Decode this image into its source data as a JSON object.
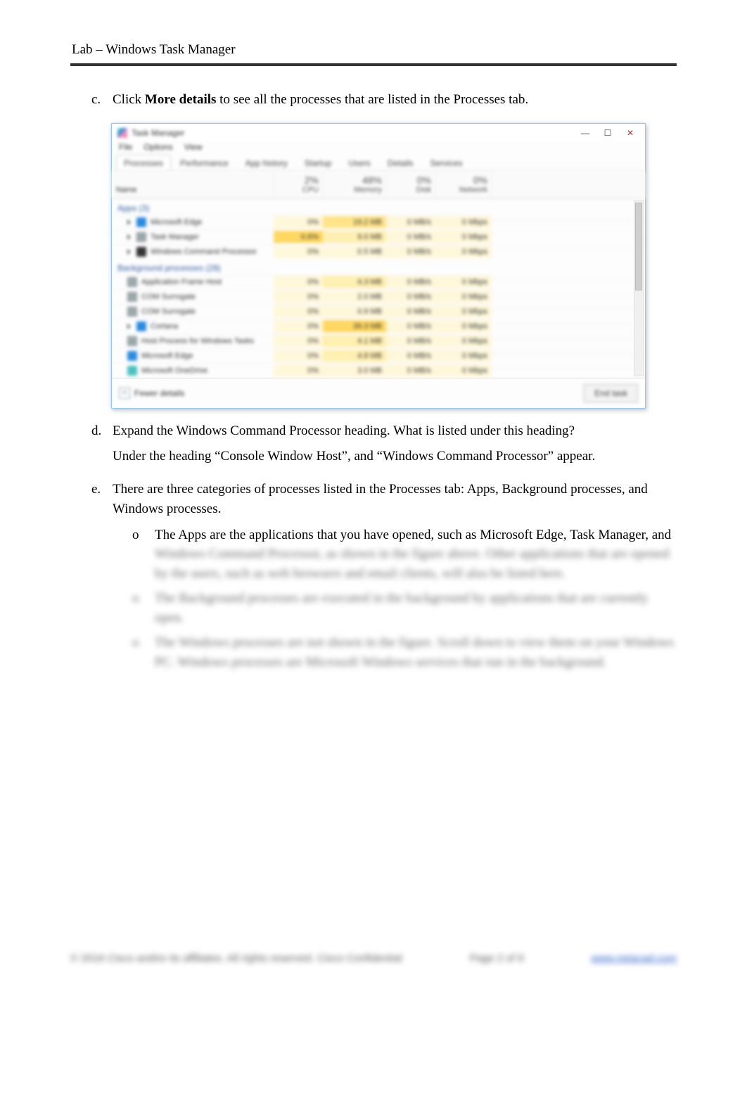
{
  "header": {
    "title": "Lab – Windows Task Manager"
  },
  "steps": {
    "c": {
      "marker": "c.",
      "text_prefix": "Click ",
      "bold": "More details",
      "text_suffix": " to see all the processes that are listed in the Processes tab."
    },
    "d": {
      "marker": "d.",
      "question": "Expand the Windows Command Processor heading. What is listed under this heading?",
      "answer": "Under the heading “Console Window Host”, and “Windows Command Processor” appear."
    },
    "e": {
      "marker": "e.",
      "intro": "There are three categories of processes listed in the Processes tab: Apps, Background processes, and Windows processes.",
      "bullets": [
        {
          "marker": "o",
          "visible_line": "The Apps are the applications that you have opened, such as Microsoft Edge, Task Manager, and",
          "hidden_line_a": "Windows Command Processor, as shown in the figure above. Other applications that are opened by",
          "hidden_line_b": "the users, such as web browsers and email clients, will also be listed here."
        },
        {
          "marker": "o",
          "hidden": "The Background processes are executed in the background by applications that are currently open."
        },
        {
          "marker": "o",
          "hidden_a": "The Windows processes are not shown in the figure. Scroll down to view them on your Windows PC.",
          "hidden_b": "Windows processes are Microsoft Windows services that run in the background."
        }
      ]
    }
  },
  "task_manager": {
    "title": "Task Manager",
    "menu": [
      "File",
      "Options",
      "View"
    ],
    "tabs": [
      "Processes",
      "Performance",
      "App history",
      "Startup",
      "Users",
      "Details",
      "Services"
    ],
    "columns": {
      "name": "Name",
      "cpu": {
        "pct": "2%",
        "label": "CPU"
      },
      "memory": {
        "pct": "48%",
        "label": "Memory"
      },
      "disk": {
        "pct": "0%",
        "label": "Disk"
      },
      "network": {
        "pct": "0%",
        "label": "Network"
      }
    },
    "sections": {
      "apps": {
        "label": "Apps (3)",
        "rows": [
          {
            "name": "Microsoft Edge",
            "cpu": "0%",
            "mem": "19.2 MB",
            "disk": "0 MB/s",
            "net": "0 Mbps",
            "iconClass": "ic-blue"
          },
          {
            "name": "Task Manager",
            "cpu": "0.6%",
            "mem": "9.0 MB",
            "disk": "0 MB/s",
            "net": "0 Mbps",
            "iconClass": "ic-gray"
          },
          {
            "name": "Windows Command Processor",
            "cpu": "0%",
            "mem": "0.5 MB",
            "disk": "0 MB/s",
            "net": "0 Mbps",
            "iconClass": "ic-dark"
          }
        ]
      },
      "background": {
        "label": "Background processes (28)",
        "rows": [
          {
            "name": "Application Frame Host",
            "cpu": "0%",
            "mem": "4.3 MB",
            "disk": "0 MB/s",
            "net": "0 Mbps",
            "iconClass": "ic-gray"
          },
          {
            "name": "COM Surrogate",
            "cpu": "0%",
            "mem": "2.0 MB",
            "disk": "0 MB/s",
            "net": "0 Mbps",
            "iconClass": "ic-gray"
          },
          {
            "name": "COM Surrogate",
            "cpu": "0%",
            "mem": "0.9 MB",
            "disk": "0 MB/s",
            "net": "0 Mbps",
            "iconClass": "ic-gray"
          },
          {
            "name": "Cortana",
            "cpu": "0%",
            "mem": "39.3 MB",
            "disk": "0 MB/s",
            "net": "0 Mbps",
            "iconClass": "ic-blue"
          },
          {
            "name": "Host Process for Windows Tasks",
            "cpu": "0%",
            "mem": "4.1 MB",
            "disk": "0 MB/s",
            "net": "0 Mbps",
            "iconClass": "ic-gray"
          },
          {
            "name": "Microsoft Edge",
            "cpu": "0%",
            "mem": "4.8 MB",
            "disk": "0 MB/s",
            "net": "0 Mbps",
            "iconClass": "ic-blue"
          },
          {
            "name": "Microsoft OneDrive",
            "cpu": "0%",
            "mem": "3.0 MB",
            "disk": "0 MB/s",
            "net": "0 Mbps",
            "iconClass": "ic-teal"
          }
        ]
      }
    },
    "footer": {
      "fewer": "Fewer details",
      "end": "End task"
    }
  },
  "page_footer": {
    "left": "© 2016 Cisco and/or its affiliates. All rights reserved. Cisco Confidential",
    "center": "Page 2 of 9",
    "right": "www.netacad.com"
  }
}
